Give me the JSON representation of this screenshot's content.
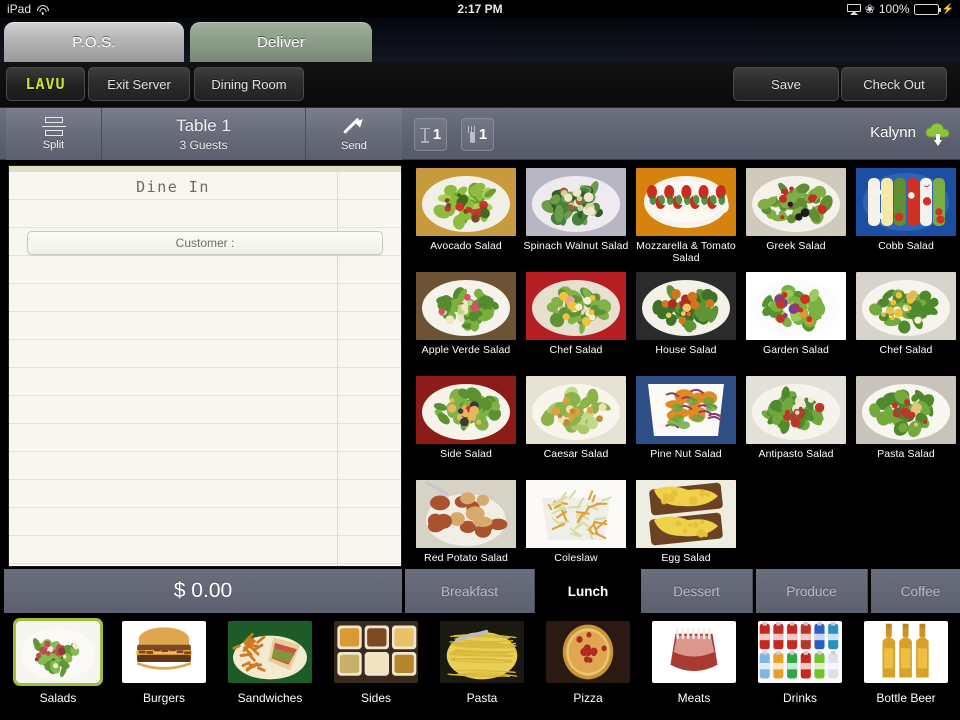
{
  "status_bar": {
    "device": "iPad",
    "wifi_icon": "wifi-icon",
    "time": "2:17 PM",
    "airplay_icon": "airplay-icon",
    "bluetooth_icon": "bluetooth-icon",
    "battery_percent": "100%",
    "charging_icon": "lightning-bolt-icon"
  },
  "mode_tabs": [
    {
      "label": "P.O.S.",
      "active": true
    },
    {
      "label": "Deliver",
      "active": false
    }
  ],
  "nav_bar": {
    "logo": "LAVU",
    "exit_server": "Exit Server",
    "dining_room": "Dining Room",
    "save": "Save",
    "check_out": "Check Out"
  },
  "order_bar": {
    "split_label": "Split",
    "table_name": "Table 1",
    "guest_count": "3 Guests",
    "send_label": "Send",
    "tables_count": "1",
    "guests_count": "1",
    "server_name": "Kalynn",
    "sync_icon": "cloud-download-icon"
  },
  "ticket": {
    "order_type": "Dine In",
    "customer_label": "Customer :",
    "items": []
  },
  "total": {
    "amount": "$ 0.00"
  },
  "meal_tabs": [
    {
      "label": "Breakfast",
      "active": false
    },
    {
      "label": "Lunch",
      "active": true
    },
    {
      "label": "Dessert",
      "active": false
    },
    {
      "label": "Produce",
      "active": false
    },
    {
      "label": "Coffee",
      "active": false
    }
  ],
  "menu_items": [
    {
      "label": "Avocado Salad",
      "img": "salad-avocado"
    },
    {
      "label": "Spinach Walnut Salad",
      "img": "salad-spinach"
    },
    {
      "label": "Mozzarella & Tomato Salad",
      "img": "salad-caprese"
    },
    {
      "label": "Greek Salad",
      "img": "salad-greek"
    },
    {
      "label": "Cobb Salad",
      "img": "salad-cobb"
    },
    {
      "label": "Apple Verde Salad",
      "img": "salad-apple-verde"
    },
    {
      "label": "Chef Salad",
      "img": "salad-chef-red"
    },
    {
      "label": "House Salad",
      "img": "salad-house"
    },
    {
      "label": "Garden Salad",
      "img": "salad-garden"
    },
    {
      "label": "Chef Salad",
      "img": "salad-chef"
    },
    {
      "label": "Side Salad",
      "img": "salad-side"
    },
    {
      "label": "Caesar Salad",
      "img": "salad-caesar"
    },
    {
      "label": "Pine Nut Salad",
      "img": "salad-pinenut"
    },
    {
      "label": "Antipasto Salad",
      "img": "salad-antipasto"
    },
    {
      "label": "Pasta Salad",
      "img": "salad-pasta"
    },
    {
      "label": "Red Potato Salad",
      "img": "salad-redpotato"
    },
    {
      "label": "Coleslaw",
      "img": "coleslaw"
    },
    {
      "label": "Egg Salad",
      "img": "egg-salad"
    }
  ],
  "categories": [
    {
      "label": "Salads",
      "img": "cat-salads",
      "selected": true
    },
    {
      "label": "Burgers",
      "img": "cat-burgers",
      "selected": false
    },
    {
      "label": "Sandwiches",
      "img": "cat-sandwiches",
      "selected": false
    },
    {
      "label": "Sides",
      "img": "cat-sides",
      "selected": false
    },
    {
      "label": "Pasta",
      "img": "cat-pasta",
      "selected": false
    },
    {
      "label": "Pizza",
      "img": "cat-pizza",
      "selected": false
    },
    {
      "label": "Meats",
      "img": "cat-meats",
      "selected": false
    },
    {
      "label": "Drinks",
      "img": "cat-drinks",
      "selected": false
    },
    {
      "label": "Bottle Beer",
      "img": "cat-bottlebeer",
      "selected": false
    }
  ],
  "colors": {
    "accent_green": "#c9e133",
    "selection_green": "#9fbf3b",
    "toolbar_gray": "#5c6070",
    "ticket_paper": "#f7f7ef"
  }
}
